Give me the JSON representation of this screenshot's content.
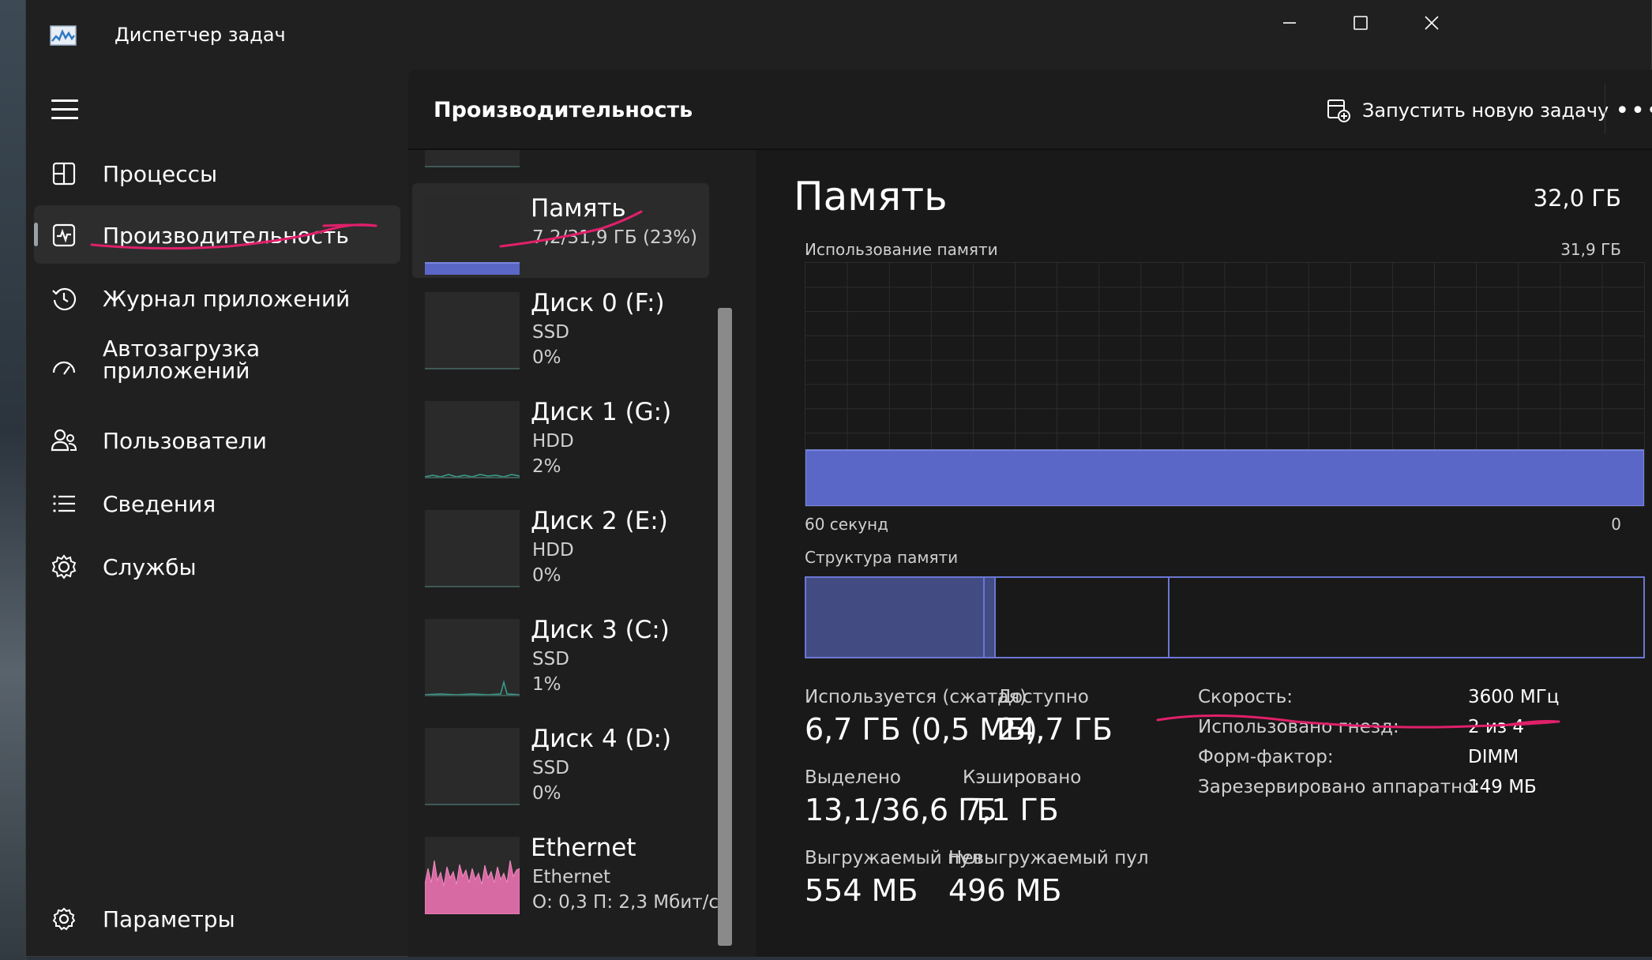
{
  "window": {
    "title": "Диспетчер задач"
  },
  "nav": {
    "items": [
      {
        "label": "Процессы"
      },
      {
        "label": "Производительность"
      },
      {
        "label": "Журнал приложений"
      },
      {
        "label": "Автозагрузка приложений"
      },
      {
        "label": "Пользователи"
      },
      {
        "label": "Сведения"
      },
      {
        "label": "Службы"
      }
    ],
    "settings": "Параметры"
  },
  "header": {
    "title": "Производительность",
    "run_task": "Запустить новую задачу"
  },
  "list": {
    "items": [
      {
        "title": "Память",
        "sub1": "7,2/31,9 ГБ (23%)",
        "sub2": ""
      },
      {
        "title": "Диск 0 (F:)",
        "sub1": "SSD",
        "sub2": "0%"
      },
      {
        "title": "Диск 1 (G:)",
        "sub1": "HDD",
        "sub2": "2%"
      },
      {
        "title": "Диск 2 (E:)",
        "sub1": "HDD",
        "sub2": "0%"
      },
      {
        "title": "Диск 3 (C:)",
        "sub1": "SSD",
        "sub2": "1%"
      },
      {
        "title": "Диск 4 (D:)",
        "sub1": "SSD",
        "sub2": "0%"
      },
      {
        "title": "Ethernet",
        "sub1": "Ethernet",
        "sub2": "О: 0,3  П: 2,3 Мбит/с"
      }
    ]
  },
  "memory": {
    "title": "Память",
    "total": "32,0 ГБ",
    "usage_label": "Использование памяти",
    "usage_max": "31,9 ГБ",
    "usage_fraction": 0.23,
    "axis_left": "60 секунд",
    "axis_right": "0",
    "structure_label": "Структура памяти",
    "stats": {
      "used_label": "Используется (сжатая)",
      "used_value": "6,7 ГБ (0,5 МБ)",
      "available_label": "Доступно",
      "available_value": "24,7 ГБ",
      "committed_label": "Выделено",
      "committed_value": "13,1/36,6 ГБ",
      "cached_label": "Кэшировано",
      "cached_value": "7,1 ГБ",
      "paged_label": "Выгружаемый пул",
      "paged_value": "554 МБ",
      "nonpaged_label": "Невыгружаемый пул",
      "nonpaged_value": "496 МБ"
    },
    "specs": {
      "speed_label": "Скорость:",
      "speed_value": "3600 МГц",
      "slots_label": "Использовано гнезд:",
      "slots_value": "2 из 4",
      "form_label": "Форм-фактор:",
      "form_value": "DIMM",
      "reserved_label": "Зарезервировано аппаратно:",
      "reserved_value": "149 МБ"
    }
  },
  "colors": {
    "accent": "#6a77d4",
    "fill": "#5b67c6",
    "annotation": "#e0206a"
  }
}
